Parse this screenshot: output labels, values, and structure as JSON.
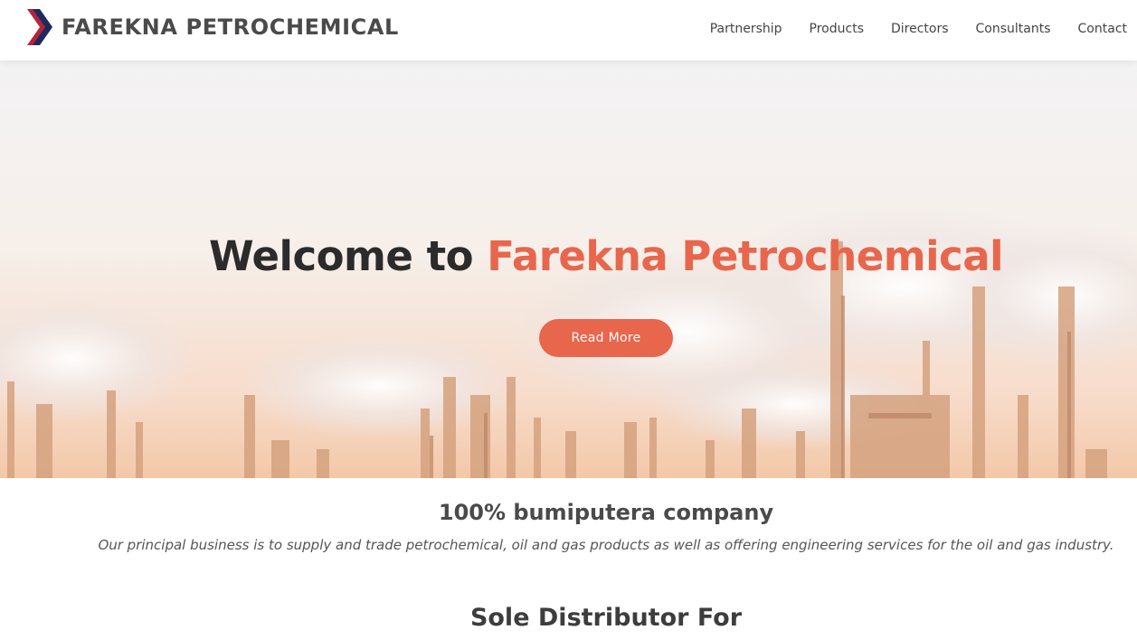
{
  "brand": {
    "name": "FAREKNA PETROCHEMICAL",
    "colors": {
      "logo_front": "#1e2a5e",
      "logo_back": "#b3243a"
    }
  },
  "nav": {
    "items": [
      {
        "label": "Partnership"
      },
      {
        "label": "Products"
      },
      {
        "label": "Directors"
      },
      {
        "label": "Consultants"
      },
      {
        "label": "Contact"
      }
    ]
  },
  "hero": {
    "title_prefix": "Welcome to",
    "title_accent": "Farekna Petrochemical",
    "button_label": "Read More",
    "background_image": "refinery-skyline",
    "colors": {
      "accent": "#e8664c"
    }
  },
  "intro": {
    "title": "100% bumiputera company",
    "text": "Our principal business is to supply and trade petrochemical, oil and gas products as well as offering engineering services for the oil and gas industry."
  },
  "distributor": {
    "title": "Sole Distributor For"
  }
}
